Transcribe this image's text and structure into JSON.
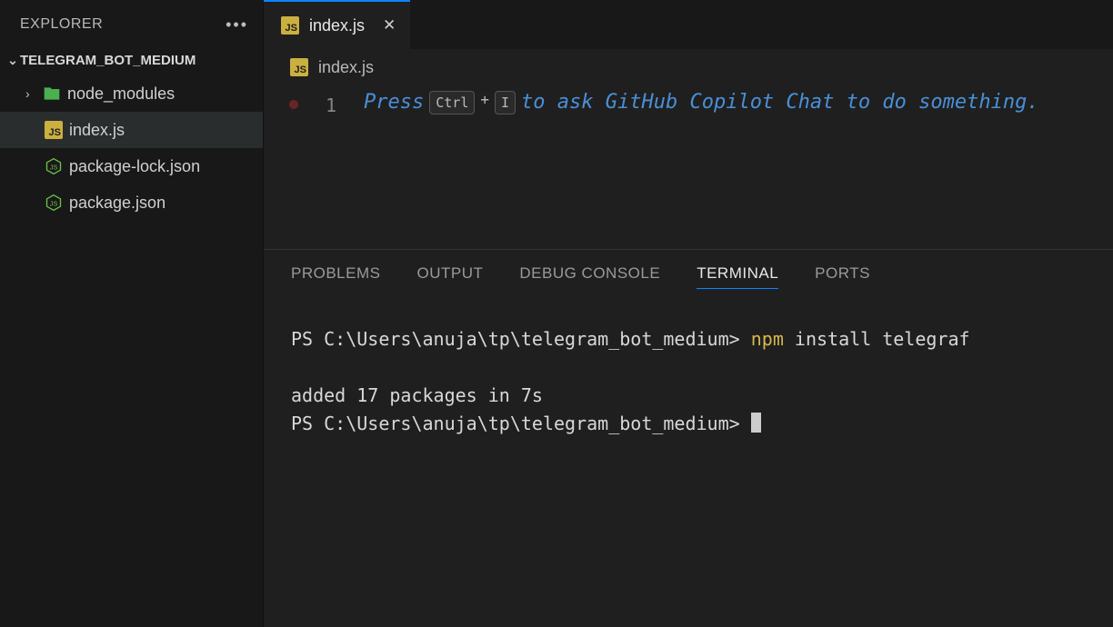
{
  "sidebar": {
    "title": "EXPLORER",
    "project": "TELEGRAM_BOT_MEDIUM",
    "items": [
      {
        "label": "node_modules",
        "type": "folder"
      },
      {
        "label": "index.js",
        "type": "js"
      },
      {
        "label": "package-lock.json",
        "type": "node"
      },
      {
        "label": "package.json",
        "type": "node"
      }
    ]
  },
  "tab": {
    "label": "index.js"
  },
  "breadcrumb": {
    "label": "index.js"
  },
  "editor": {
    "line_number": "1",
    "hint_pre": "Press",
    "key1": "Ctrl",
    "key2": "I",
    "hint_post": "to ask GitHub Copilot Chat to do something."
  },
  "panel": {
    "tabs": {
      "problems": "PROBLEMS",
      "output": "OUTPUT",
      "debug": "DEBUG CONSOLE",
      "terminal": "TERMINAL",
      "ports": "PORTS"
    }
  },
  "terminal": {
    "prompt1_prefix": "PS C:\\Users\\anuja\\tp\\telegram_bot_medium> ",
    "cmd_highlight": "npm",
    "cmd_rest": " install telegraf",
    "blank": "",
    "output1": "added 17 packages in 7s",
    "prompt2": "PS C:\\Users\\anuja\\tp\\telegram_bot_medium> "
  }
}
